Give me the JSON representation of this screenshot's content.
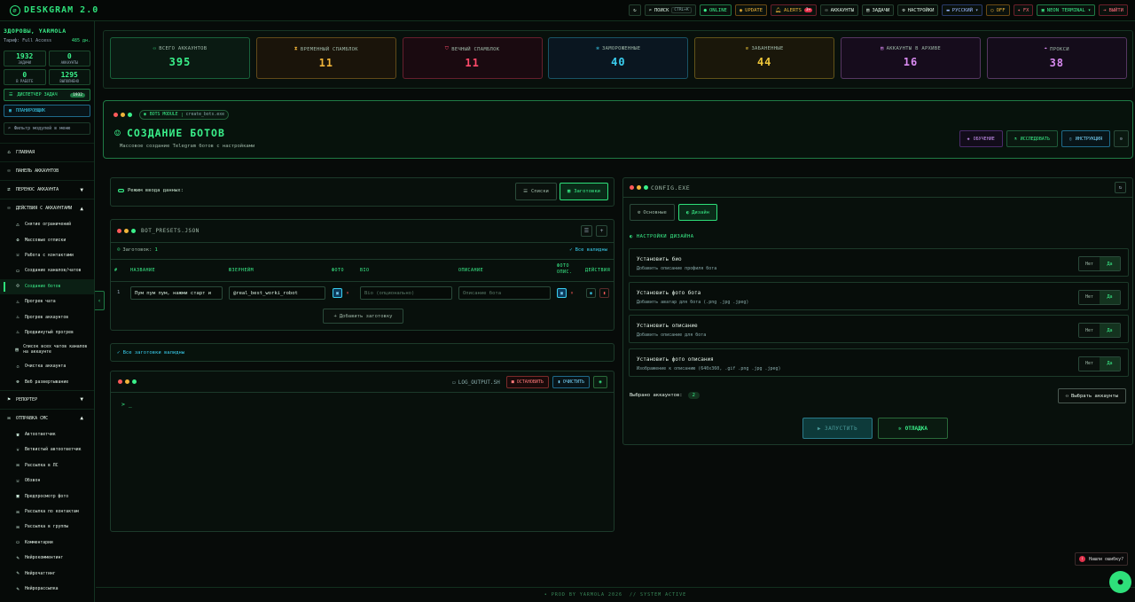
{
  "app": {
    "title": "DESKGRAM 2.0"
  },
  "topbar": {
    "search_label": "ПОИСК",
    "search_kbd": "CTRL+K",
    "online": "ONLINE",
    "update": "UPDATE",
    "alerts": "ALERTS",
    "alerts_count": "3+",
    "accounts": "АККАУНТЫ",
    "tasks": "ЗАДАЧИ",
    "settings": "НАСТРОЙКИ",
    "language": "РУССКИЙ",
    "off": "OFF",
    "fx": "FX",
    "theme": "NEON TERMINAL",
    "logout": "ВЫЙТИ"
  },
  "user": {
    "greeting": "ЗДОРОВЫ, YARMOLA",
    "tariff_label": "Тариф: Full Access",
    "days": "485 дн."
  },
  "user_stats": [
    {
      "value": "1932",
      "label": "ЗАДАЧИ"
    },
    {
      "value": "0",
      "label": "АККАУНТЫ"
    },
    {
      "value": "0",
      "label": "В РАБОТЕ"
    },
    {
      "value": "1295",
      "label": "ВЫПОЛНЕНО"
    }
  ],
  "sidebar": {
    "task_manager": "ДИСПЕТЧЕР ЗАДАЧ",
    "task_manager_badge": "1932",
    "scheduler": "ПЛАНИРОВЩИК",
    "filter_placeholder": "Фильтр модулей в меню",
    "top_items": [
      "ГЛАВНАЯ",
      "ПАНЕЛЬ АККАУНТОВ",
      "ПЕРЕНОС АККАУНТА",
      "ДЕЙСТВИЯ С АККАУНТАМИ"
    ],
    "actions_sub": [
      "Снятие ограничений",
      "Массовые отписки",
      "Работа с контактами",
      "Создание каналов/чатов",
      "Создание ботов",
      "Прогрев чата",
      "Прогрев аккаунтов",
      "Продвинутый прогрев",
      "Список всех чатов каналов на аккаунте",
      "Очистка аккаунта",
      "Веб развертывание"
    ],
    "section2": "РЕПОРТЕР",
    "section3": "ОТПРАВКА СМС",
    "sms_sub": [
      "Автоответчик",
      "Ветвистый автоответчик",
      "Рассылка в ЛС",
      "Обзвон",
      "Предпросмотр фото",
      "Рассылка по контактам",
      "Рассылка в группы",
      "Комментарии",
      "Нейрокомментинг",
      "Нейрочаттинг",
      "Нейрорассылка"
    ]
  },
  "summary_cards": [
    {
      "title": "ВСЕГО АККАУНТОВ",
      "value": "395",
      "color": "#3af08a",
      "icon": "users-icon"
    },
    {
      "title": "ВРЕМЕННЫЙ СПАМБЛОК",
      "value": "11",
      "color": "#f0b43a",
      "icon": "hourglass-icon"
    },
    {
      "title": "ВЕЧНЫЙ СПАМБЛОК",
      "value": "11",
      "color": "#ff4a6a",
      "icon": "shield-icon"
    },
    {
      "title": "ЗАМОРОЖЕННЫЕ",
      "value": "40",
      "color": "#3acff0",
      "icon": "snowflake-icon"
    },
    {
      "title": "ЗАБАНЕННЫЕ",
      "value": "44",
      "color": "#f0c83a",
      "icon": "ban-icon"
    },
    {
      "title": "АККАУНТЫ В АРХИВЕ",
      "value": "16",
      "color": "#d88af0",
      "icon": "archive-icon"
    },
    {
      "title": "ПРОКСИ",
      "value": "38",
      "color": "#d88af0",
      "icon": "pin-icon"
    }
  ],
  "hero": {
    "module_label": "BOTS MODULE",
    "module_file": "create_bots.exe",
    "title": "СОЗДАНИЕ БОТОВ",
    "subtitle": "Массовое создание Telegram ботов с настройками",
    "btn_learn": "ОБУЧЕНИЕ",
    "btn_research": "ИССЛЕДОВАТЬ",
    "btn_instruction": "ИНСТРУКЦИЯ"
  },
  "mode": {
    "label": "Режим ввода данных:",
    "lists": "Списки",
    "templates": "Заготовки"
  },
  "presets": {
    "file": "BOT_PRESETS.JSON",
    "count_label": "Заготовок:",
    "count": "1",
    "all_valid": "Все валидны",
    "columns": [
      "#",
      "НАЗВАНИЕ",
      "ЮЗЕРНЕЙМ",
      "ФОТО",
      "BIO",
      "ОПИСАНИЕ",
      "ФОТО ОПИС.",
      "ДЕЙСТВИЯ"
    ],
    "row": {
      "num": "1",
      "name": "Пум пум пум, нажми старт и",
      "username": "@real_best_worki_robot",
      "bio_placeholder": "Bio (опционально)",
      "desc_placeholder": "Описание бота"
    },
    "add": "Добавить заготовку"
  },
  "all_presets_valid": "Все заготовки валидны",
  "log": {
    "file": "LOG_OUTPUT.SH",
    "stop": "ОСТАНОВИТЬ",
    "clear": "ОЧИСТИТЬ",
    "prompt": "> _"
  },
  "config": {
    "title": "CONFIG.EXE",
    "tab_main": "Основные",
    "tab_design": "Дизайн",
    "section": "НАСТРОЙКИ ДИЗАЙНА",
    "options": [
      {
        "title": "Установить био",
        "desc": "Добавить описание профиля бота"
      },
      {
        "title": "Установить фото бота",
        "desc": "Добавить аватар для бота (.png .jpg .jpeg)"
      },
      {
        "title": "Установить описание",
        "desc": "Добавить описание для бота"
      },
      {
        "title": "Установить фото описания",
        "desc": "Изображение к описанию (640x360, .gif .png .jpg .jpeg)"
      }
    ],
    "no": "Нет",
    "yes": "Да",
    "selected_label": "Выбрано аккаунтов:",
    "selected_count": "2",
    "select_btn": "Выбрать аккаунты",
    "run": "ЗАПУСТИТЬ",
    "debug": "ОТЛАДКА"
  },
  "footer": {
    "left": "• PROD BY YARMOLA 2026",
    "right": "// SYSTEM ACTIVE"
  },
  "bug": "Нашли ошибку?"
}
